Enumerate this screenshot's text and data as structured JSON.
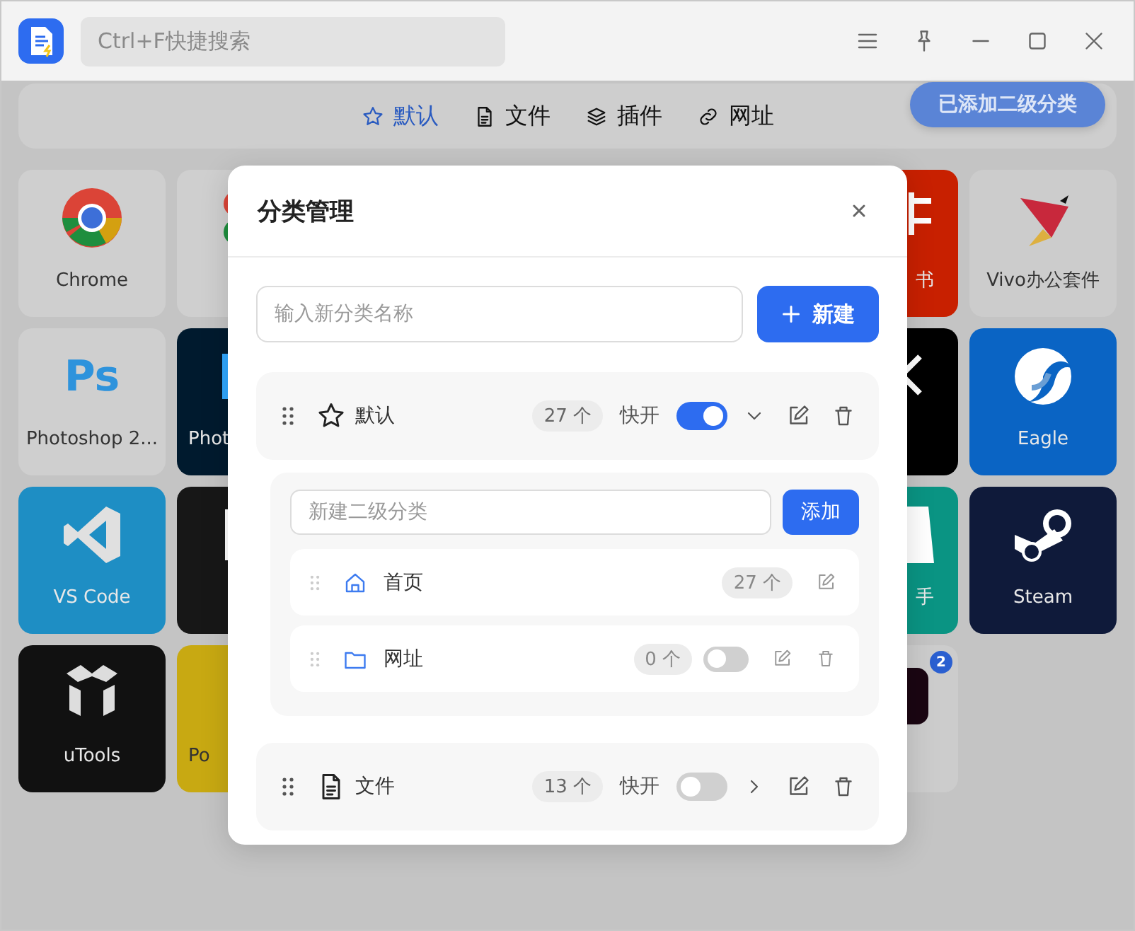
{
  "titlebar": {
    "search": {
      "placeholder": "Ctrl+F快捷搜索"
    }
  },
  "nav": {
    "tabs": [
      {
        "label": "默认",
        "selected": true
      },
      {
        "label": "文件",
        "selected": false
      },
      {
        "label": "插件",
        "selected": false
      },
      {
        "label": "网址",
        "selected": false
      }
    ]
  },
  "toast": "已添加二级分类",
  "tiles": {
    "rows": [
      {
        "left": [
          {
            "label": "Chrome",
            "color": "#cfcfcf"
          },
          {
            "color": "#cfcfcf"
          }
        ],
        "right": [
          {
            "label": "书",
            "color": "#c82000"
          },
          {
            "label": "Vivo办公套件",
            "color": "#cccccc"
          }
        ]
      },
      {
        "left": [
          {
            "label": "Photoshop 2...",
            "color": "#cfcfcf",
            "icon_text": "Ps"
          },
          {
            "label": "Phot",
            "color": "#001a2e"
          }
        ],
        "right": [
          {
            "color": "#000000"
          },
          {
            "label": "Eagle",
            "color": "#0a64c4"
          }
        ]
      },
      {
        "left": [
          {
            "label": "VS Code",
            "color": "#1e8ec4"
          },
          {
            "color": "#171717"
          }
        ],
        "right": [
          {
            "label": "手",
            "color": "#0a9483"
          },
          {
            "label": "Steam",
            "color": "#0f1a3a"
          }
        ]
      },
      {
        "left": [
          {
            "label": "uTools",
            "color": "#111111"
          },
          {
            "label": "Po",
            "color": "#c8a912"
          }
        ],
        "right": [
          {
            "color": "#cccccc",
            "badge": "2"
          }
        ]
      }
    ]
  },
  "dialog": {
    "title": "分类管理",
    "new_category": {
      "placeholder": "输入新分类名称",
      "button": "新建"
    },
    "categories": [
      {
        "name": "默认",
        "count": "27 个",
        "quick_label": "快开",
        "on": true,
        "expanded": true,
        "sub": {
          "placeholder": "新建二级分类",
          "button": "添加",
          "items": [
            {
              "kind": "fixed",
              "name": "首页",
              "count": "27 个"
            },
            {
              "kind": "custom",
              "name": "网址",
              "count": "0 个",
              "on": false
            }
          ]
        }
      },
      {
        "name": "文件",
        "count": "13 个",
        "quick_label": "快开",
        "on": false,
        "expanded": false
      }
    ]
  }
}
